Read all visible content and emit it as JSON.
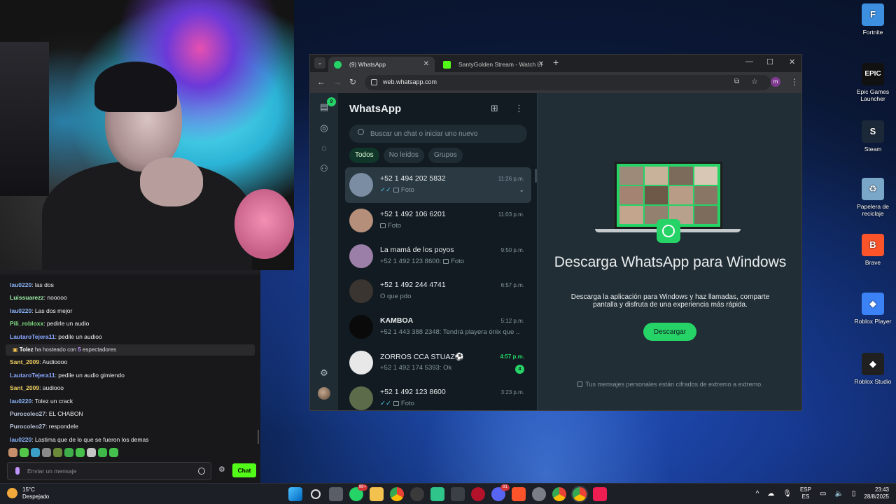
{
  "webcam": {},
  "stream_chat": {
    "messages": [
      {
        "user": "lau0220",
        "text": ": las dos",
        "color": "#8ab4f8"
      },
      {
        "user": "Luissuarezz",
        "text": ": nooooo",
        "color": "#9ef0a8"
      },
      {
        "user": "lau0220",
        "text": ": Las dos mejor",
        "color": "#8ab4f8"
      },
      {
        "user": "Pili_robloxx",
        "text": ": pedirle un audio",
        "color": "#7ee07e"
      },
      {
        "user": "LautaroTejera11",
        "text": ": pedile un audioo",
        "color": "#8aa8ff"
      }
    ],
    "notice": {
      "user": "Tolez",
      "middle": " ha hosteado con ",
      "count": "5",
      "suffix": " espectadores"
    },
    "messages2": [
      {
        "user": "Sant_2009",
        "text": ": Audioooo",
        "color": "#f0d060"
      },
      {
        "user": "LautaroTejera11",
        "text": ": pedile un audio gimiendo",
        "color": "#8aa8ff"
      },
      {
        "user": "Sant_2009",
        "text": ": audiooo",
        "color": "#f0d060"
      },
      {
        "user": "lau0220",
        "text": ": Tolez un crack",
        "color": "#8ab4f8"
      },
      {
        "user": "Purocoleo27",
        "text": ": EL CHABON",
        "color": "#b9c3d8"
      },
      {
        "user": "Purocoleo27",
        "text": ": respondele",
        "color": "#b9c3d8"
      },
      {
        "user": "lau0220",
        "text": ": Lastima que de lo que se fueron los demas",
        "color": "#8ab4f8"
      }
    ],
    "input_placeholder": "Enviar un mensaje",
    "send_label": "Chat"
  },
  "desktop_icons": [
    {
      "label": "Fortnite",
      "glyph": "F",
      "color": "#3d8fe0"
    },
    {
      "label": "Epic Games Launcher",
      "glyph": "EPIC",
      "color": "#111111"
    },
    {
      "label": "Steam",
      "glyph": "S",
      "color": "#1b2838"
    },
    {
      "label": "Papelera de reciclaje",
      "glyph": "♻",
      "color": "#7aa6c8"
    },
    {
      "label": "Brave",
      "glyph": "B",
      "color": "#fb542b"
    },
    {
      "label": "Roblox Player",
      "glyph": "◆",
      "color": "#3b82f6"
    },
    {
      "label": "Roblox Studio",
      "glyph": "◆",
      "color": "#202020"
    }
  ],
  "browser": {
    "tabs": [
      {
        "title": "(9) WhatsApp",
        "color": "#25d366"
      },
      {
        "title": "SantyGolden Stream - Watch Li",
        "color": "#53fc18"
      }
    ],
    "url": "web.whatsapp.com",
    "profile_initial": "m"
  },
  "whatsapp": {
    "title": "WhatsApp",
    "rail_badge": "9",
    "search_placeholder": "Buscar un chat o iniciar uno nuevo",
    "filters": [
      "Todos",
      "No leídos",
      "Grupos"
    ],
    "chats": [
      {
        "name": "+52 1 494 202 5832",
        "time": "11:26 p.m.",
        "preview": "Foto",
        "tick": true,
        "photo": true,
        "selected": true,
        "avatar": "#7b8da3"
      },
      {
        "name": "+52 1 492 106 6201",
        "time": "11:03 p.m.",
        "preview": "Foto",
        "tick": false,
        "photo": true,
        "avatar": "#b58f7a"
      },
      {
        "name": "La mamá de los poyos",
        "time": "9:50 p.m.",
        "preview": "+52 1 492 123 8600: ",
        "preview2": "Foto",
        "photo2": true,
        "avatar": "#9b7fa8"
      },
      {
        "name": "+52 1 492 244 4741",
        "time": "6:57 p.m.",
        "preview": "O que pdo",
        "avatar": "#3a3530"
      },
      {
        "name": "KAMBOA",
        "time": "5:12 p.m.",
        "preview": "+52 1 443 388 2348: Tendrá playera ónix que ...",
        "bold": true,
        "avatar": "#0a0a0a"
      },
      {
        "name": "ZORROS CCA STUAZ⚽",
        "time": "4:57 p.m.",
        "preview": "+52 1 492 174 5393: Ok",
        "unread": "4",
        "avatar": "#e8e8e8"
      },
      {
        "name": "+52 1 492 123 8600",
        "time": "3:23 p.m.",
        "preview": "Foto",
        "tick": true,
        "photo": true,
        "avatar": "#5c6b4a"
      }
    ],
    "intro_title": "Descarga WhatsApp para Windows",
    "intro_text": "Descarga la aplicación para Windows y haz llamadas, comparte pantalla y disfruta de una experiencia más rápida.",
    "download_label": "Descargar",
    "encryption_note": "Tus mensajes personales están cifrados de extremo a extremo."
  },
  "taskbar": {
    "temperature": "15°C",
    "weather": "Despejado",
    "language": "ESP",
    "layout": "ES",
    "time": "23:43",
    "date": "28/8/2025",
    "whatsapp_badge": "99+",
    "discord_badge": "91"
  }
}
